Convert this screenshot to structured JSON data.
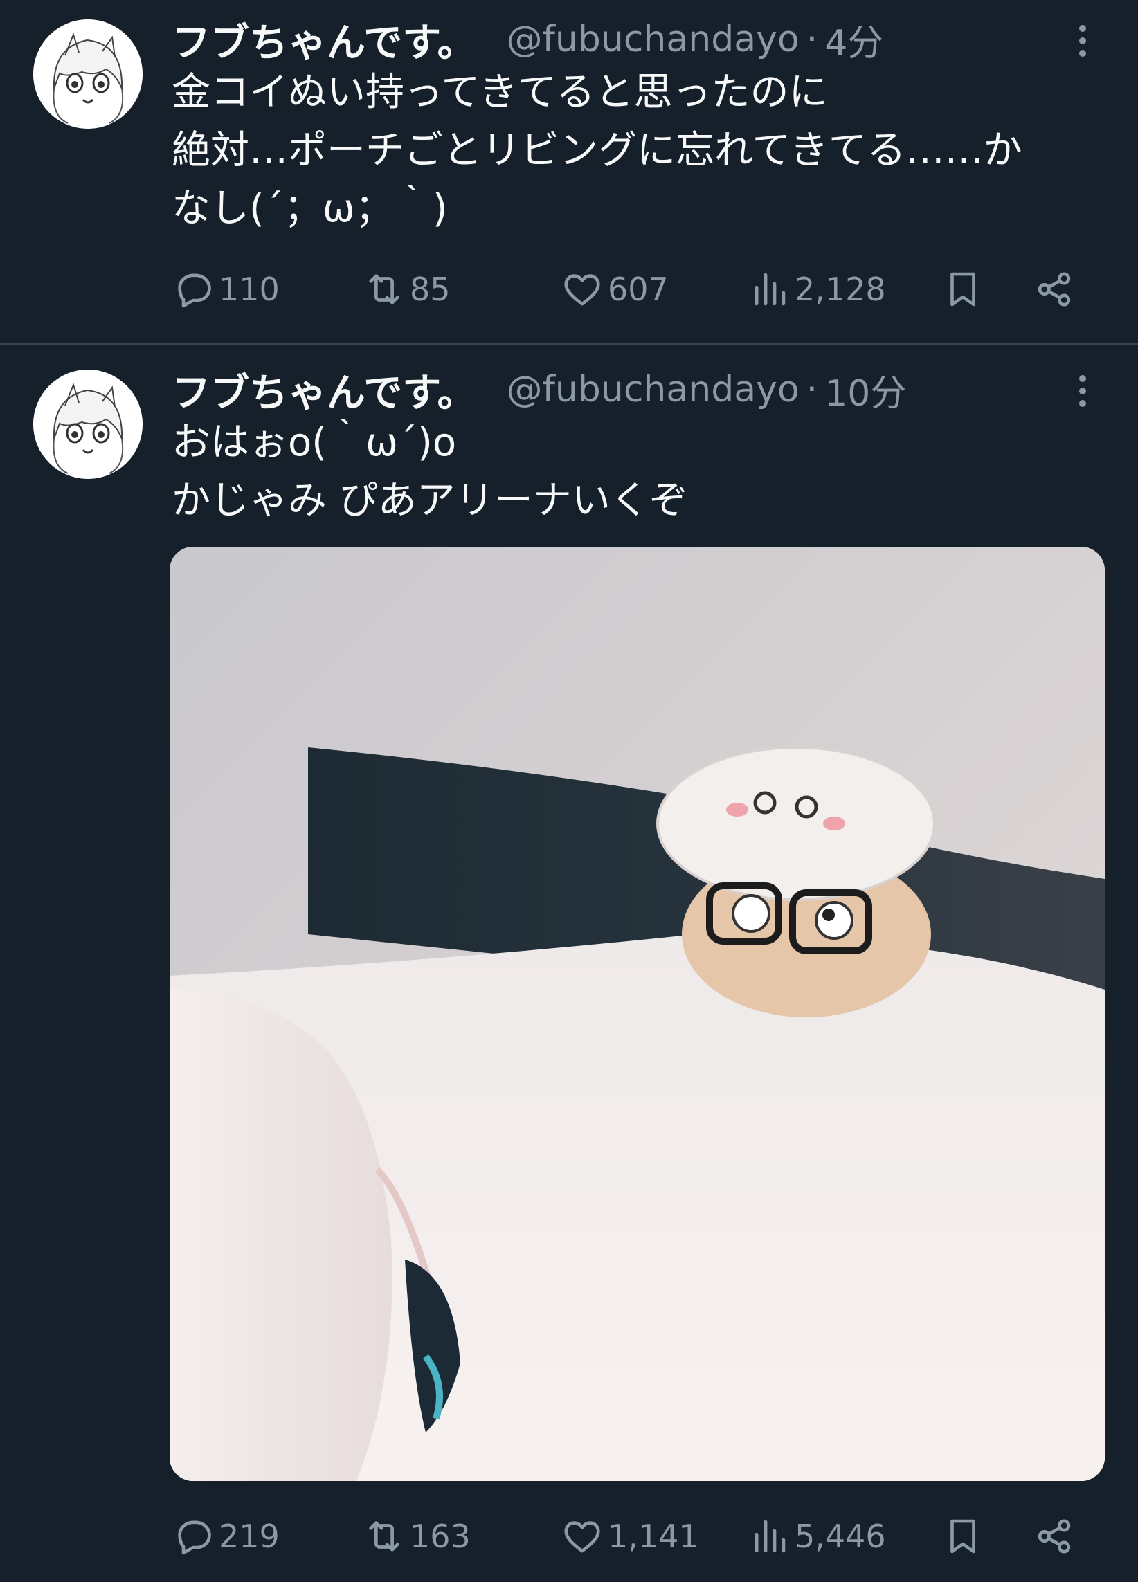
{
  "colors": {
    "background": "#15202b",
    "text_primary": "#f7f9f9",
    "text_secondary": "#8b98a5",
    "divider": "#38444d"
  },
  "tweets": [
    {
      "display_name": "フブちゃんです。",
      "handle": "@fubuchandayo",
      "separator": "·",
      "time": "4分",
      "text_lines": [
        "金コイぬい持ってきてると思ったのに",
        "絶対…ポーチごとリビングに忘れてきてる……か",
        "なし(´；ω；｀)"
      ],
      "icons": {
        "avatar": "avatar-image",
        "more": "more-icon",
        "reply": "reply-icon",
        "retweet": "retweet-icon",
        "like": "heart-icon",
        "views": "views-icon",
        "bookmark": "bookmark-icon",
        "share": "share-icon"
      },
      "stats": {
        "replies": "110",
        "retweets": "85",
        "likes": "607",
        "views": "2,128"
      }
    },
    {
      "display_name": "フブちゃんです。",
      "handle": "@fubuchandayo",
      "separator": "·",
      "time": "10分",
      "text_lines": [
        "おはぉo(｀ω´)o",
        "かじゃみ ぴあアリーナいくぞ"
      ],
      "media": {
        "type": "photo",
        "subject": "figure-in-cat-hat-peeking-from-blanket"
      },
      "icons": {
        "avatar": "avatar-image",
        "more": "more-icon",
        "reply": "reply-icon",
        "retweet": "retweet-icon",
        "like": "heart-icon",
        "views": "views-icon",
        "bookmark": "bookmark-icon",
        "share": "share-icon"
      },
      "stats": {
        "replies": "219",
        "retweets": "163",
        "likes": "1,141",
        "views": "5,446"
      }
    }
  ]
}
